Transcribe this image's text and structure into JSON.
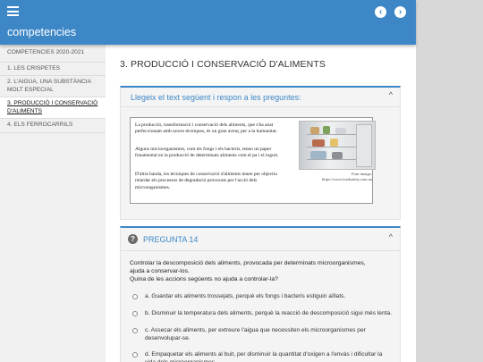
{
  "header": {
    "app_title": "competencies",
    "menu_icon": "hamburger-menu-icon",
    "prev_icon": "chevron-left-icon",
    "next_icon": "chevron-right-icon",
    "prev_glyph": "‹",
    "next_glyph": "›",
    "accent_color": "#3d87c7"
  },
  "sidebar": {
    "items": [
      {
        "label": "COMPETENCIES 2020-2021"
      },
      {
        "label": "1. LES CRISPETES"
      },
      {
        "label": "2. L'AIGUA, UNA SUBSTÀNCIA MOLT ESPECIAL"
      },
      {
        "label": "3. PRODUCCIÓ I CONSERVACIÓ D'ALIMENTS",
        "active": true
      },
      {
        "label": "4. ELS FERROCARRILS"
      }
    ]
  },
  "main": {
    "section_title": "3. PRODUCCIÓ I CONSERVACIÓ D'ALIMENTS",
    "reading_card": {
      "header": "Llegeix el text següent i respon a les preguntes:",
      "collapse_glyph": "^",
      "paragraphs": [
        "La producció, transformació i conservació dels aliments, que s'ha anat perfeccionant amb noves tècniques, és un gran avenç per a la humanitat.",
        "Alguns microorganismes, com els fongs i els bacteris, tenen un paper fonamental en la producció de determinats aliments com el pa i el iogurt.",
        "D'altra banda, les tècniques de conservació d'aliments tenen per objectiu retardar els processos de degradació provocats per l'acció dels microorganismes."
      ],
      "image_credit_line1": "Font imatge:",
      "image_credit_line2": "https://www.foodsafety.com.au"
    },
    "question_card": {
      "title": "PREGUNTA 14",
      "icon_glyph": "?",
      "collapse_glyph": "^",
      "question_line1": "Controlar la descomposició dels aliments, provocada per determinats microorganismes,",
      "question_line2": "ajuda a conservar-los.",
      "question_line3": "Quina de les accions següents no ajuda a controlar-la?",
      "options": [
        {
          "label": "a. Guardar els aliments trossejats, perquè els fongs i bacteris estiguin aïllats."
        },
        {
          "label": "b. Disminuir la temperatura dels aliments, perquè la reacció de descomposició sigui més lenta."
        },
        {
          "label": "c. Assecar els aliments, per extreure l'aigua que necessiten els microorganismes per desenvolupar-se."
        },
        {
          "label": "d. Empaquetar els aliments al buit, per disminuir la quantitat d'oxigen a l'envàs i dificultar la vida dels microorganismes."
        }
      ]
    }
  }
}
